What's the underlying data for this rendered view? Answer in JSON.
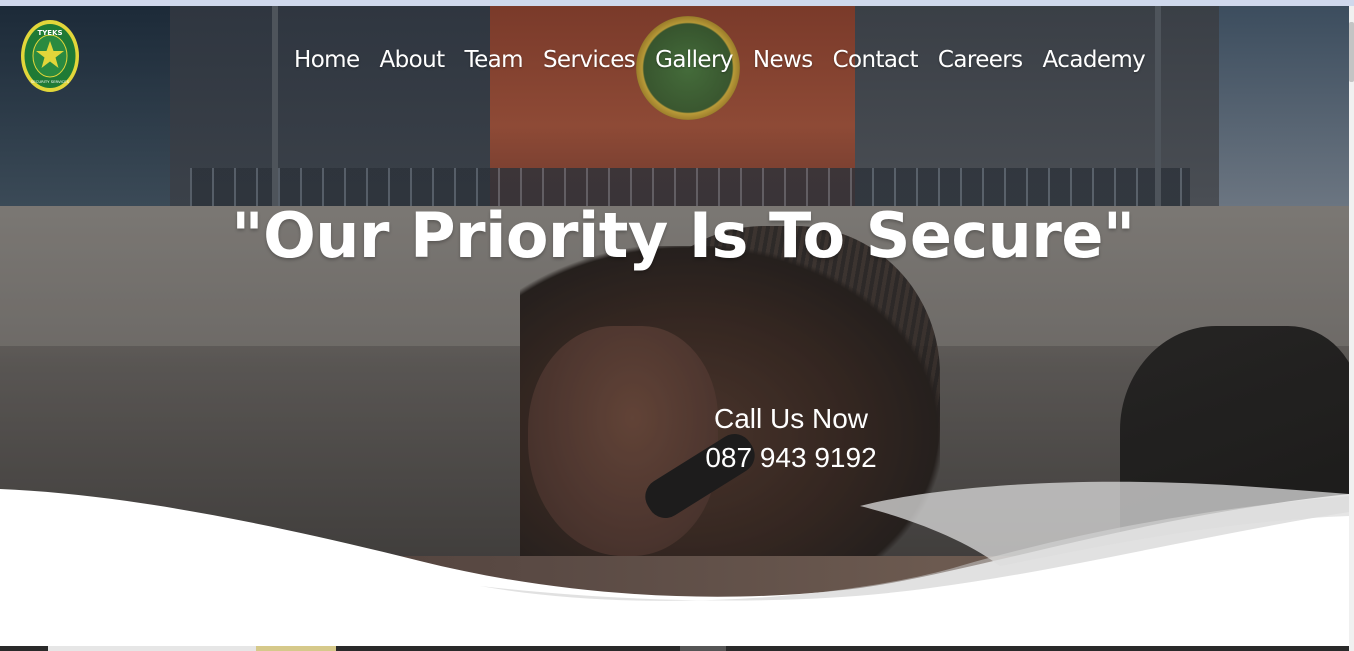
{
  "brand": {
    "logo_text_top": "TYEKS",
    "logo_text_bottom": "SECURITY SERVICES",
    "colors": {
      "ring": "#e2d63a",
      "inner": "#1f7a35"
    }
  },
  "nav": {
    "items": [
      {
        "label": "Home"
      },
      {
        "label": "About"
      },
      {
        "label": "Team"
      },
      {
        "label": "Services"
      },
      {
        "label": "Gallery"
      },
      {
        "label": "News"
      },
      {
        "label": "Contact"
      },
      {
        "label": "Careers"
      },
      {
        "label": "Academy"
      }
    ]
  },
  "hero": {
    "headline": "\"Our Priority Is To Secure\"",
    "cta_label": "Call Us Now",
    "cta_phone": "087 943 9192"
  }
}
